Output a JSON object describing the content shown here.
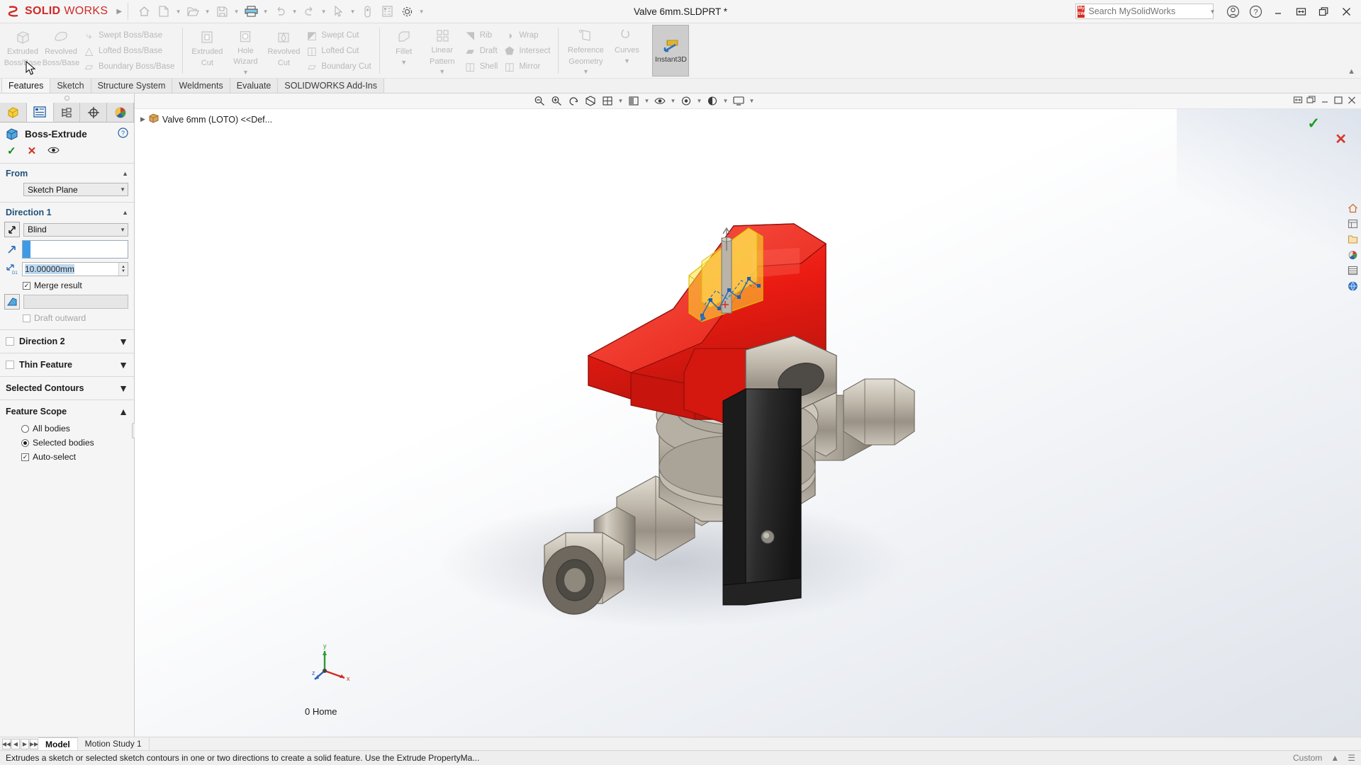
{
  "titlebar": {
    "brand_ds": "3S",
    "brand_solid": "SOLID",
    "brand_works": "WORKS",
    "document_title": "Valve 6mm.SLDPRT *",
    "quick_access": [
      {
        "name": "home-icon",
        "glyph": "⌂",
        "has_dropdown": false
      },
      {
        "name": "new-document-icon",
        "glyph": "▢",
        "has_dropdown": true
      },
      {
        "name": "open-folder-icon",
        "glyph": "◱",
        "has_dropdown": true
      },
      {
        "name": "save-icon",
        "glyph": "Ὃe",
        "has_dropdown": true
      },
      {
        "name": "print-icon",
        "glyph": "⎙",
        "has_dropdown": true
      },
      {
        "name": "undo-icon",
        "glyph": "↶",
        "has_dropdown": true
      },
      {
        "name": "redo-icon",
        "glyph": "↷",
        "has_dropdown": true
      },
      {
        "name": "select-arrow-icon",
        "glyph": "➤",
        "has_dropdown": true
      },
      {
        "name": "measure-icon",
        "glyph": "○",
        "has_dropdown": false
      },
      {
        "name": "rebuild-icon",
        "glyph": "☰",
        "has_dropdown": false
      },
      {
        "name": "options-gear-icon",
        "glyph": "⚙",
        "has_dropdown": true
      }
    ],
    "search_placeholder": "Search MySolidWorks",
    "search_value": "",
    "mysw_line1": "My",
    "mysw_line2": "SW",
    "account_icon": "ⓘ",
    "help_icon": "?",
    "minimize": "–",
    "restore": "⧉",
    "maximize": "❐",
    "close": "✕"
  },
  "ribbon": {
    "groups": [
      {
        "name": "boss-base-group",
        "big": [
          {
            "label1": "Extruded",
            "label2": "Boss/Base",
            "icon": "extruded-boss-base-icon",
            "glyph": "⬟"
          },
          {
            "label1": "Revolved",
            "label2": "Boss/Base",
            "icon": "revolved-boss-base-icon",
            "glyph": "◔"
          }
        ],
        "small": [
          {
            "label": "Swept Boss/Base",
            "icon": "swept-boss-base-icon",
            "glyph": "⤴"
          },
          {
            "label": "Lofted Boss/Base",
            "icon": "lofted-boss-base-icon",
            "glyph": "▲"
          },
          {
            "label": "Boundary Boss/Base",
            "icon": "boundary-boss-base-icon",
            "glyph": "▱"
          }
        ]
      },
      {
        "name": "cut-group",
        "big": [
          {
            "label1": "Extruded",
            "label2": "Cut",
            "icon": "extruded-cut-icon",
            "glyph": "▣",
            "caret": false
          },
          {
            "label1": "Hole",
            "label2": "Wizard",
            "icon": "hole-wizard-icon",
            "glyph": "◎",
            "caret": true
          },
          {
            "label1": "Revolved",
            "label2": "Cut",
            "icon": "revolved-cut-icon",
            "glyph": "∩"
          }
        ],
        "small": [
          {
            "label": "Swept Cut",
            "icon": "swept-cut-icon",
            "glyph": "◩"
          },
          {
            "label": "Lofted Cut",
            "icon": "lofted-cut-icon",
            "glyph": "◫"
          },
          {
            "label": "Boundary Cut",
            "icon": "boundary-cut-icon",
            "glyph": "▱"
          }
        ]
      },
      {
        "name": "feature-group",
        "big": [
          {
            "label1": "Fillet",
            "label2": "",
            "icon": "fillet-icon",
            "glyph": "◖",
            "caret": true
          },
          {
            "label1": "Linear",
            "label2": "Pattern",
            "icon": "linear-pattern-icon",
            "glyph": "∷",
            "caret": true
          }
        ],
        "small": [
          {
            "label": "Rib",
            "icon": "rib-icon",
            "glyph": "◥"
          },
          {
            "label": "Draft",
            "icon": "draft-icon",
            "glyph": "▰"
          },
          {
            "label": "Shell",
            "icon": "shell-icon",
            "glyph": "◫"
          }
        ],
        "small2": [
          {
            "label": "Wrap",
            "icon": "wrap-icon",
            "glyph": "◑"
          },
          {
            "label": "Intersect",
            "icon": "intersect-icon",
            "glyph": "⬟"
          },
          {
            "label": "Mirror",
            "icon": "mirror-icon",
            "glyph": "◫"
          }
        ]
      },
      {
        "name": "reference-group",
        "big": [
          {
            "label1": "Reference",
            "label2": "Geometry",
            "icon": "reference-geometry-icon",
            "glyph": "◱",
            "caret": true
          },
          {
            "label1": "Curves",
            "label2": "",
            "icon": "curves-icon",
            "glyph": "∿",
            "caret": true
          }
        ]
      }
    ],
    "instant3d": {
      "label": "Instant3D",
      "icon": "instant3d-icon",
      "glyph": "↙",
      "active": true
    },
    "collapse_icon": "⌃"
  },
  "tabs": [
    {
      "label": "Features",
      "active": true
    },
    {
      "label": "Sketch",
      "active": false
    },
    {
      "label": "Structure System",
      "active": false
    },
    {
      "label": "Weldments",
      "active": false
    },
    {
      "label": "Evaluate",
      "active": false
    },
    {
      "label": "SOLIDWORKS Add-Ins",
      "active": false
    }
  ],
  "property_manager": {
    "tabs": [
      {
        "name": "feature-manager-tab",
        "glyph": "⬟",
        "active": false
      },
      {
        "name": "property-manager-tab",
        "glyph": "☰",
        "active": true
      },
      {
        "name": "configuration-manager-tab",
        "glyph": "⑂",
        "active": false
      },
      {
        "name": "dimxpert-manager-tab",
        "glyph": "⊕",
        "active": false
      },
      {
        "name": "display-manager-tab",
        "glyph": "◕",
        "active": false
      }
    ],
    "title": "Boss-Extrude",
    "title_icon": "boss-extrude-icon",
    "actions": {
      "ok": "✓",
      "cancel": "✕",
      "preview": "◉"
    },
    "from": {
      "section": "From",
      "value": "Sketch Plane",
      "chevron": "⌄"
    },
    "direction1": {
      "section": "Direction 1",
      "end_condition": "Blind",
      "direction_icon": "reverse-direction-icon",
      "selection_value": "",
      "depth_value": "10.00000mm",
      "merge_result": {
        "label": "Merge result",
        "checked": true
      },
      "draft_angle": "",
      "draft_outward": {
        "label": "Draft outward",
        "checked": false,
        "disabled": true
      }
    },
    "direction2": {
      "label": "Direction 2",
      "checked": false
    },
    "thin_feature": {
      "label": "Thin Feature",
      "checked": false
    },
    "selected_contours": {
      "label": "Selected Contours"
    },
    "feature_scope": {
      "label": "Feature Scope",
      "options": [
        {
          "label": "All bodies",
          "selected": false
        },
        {
          "label": "Selected bodies",
          "selected": true
        }
      ],
      "auto_select": {
        "label": "Auto-select",
        "checked": true
      }
    },
    "chevrons": {
      "up": "⌃",
      "down": "⌄"
    }
  },
  "graphics": {
    "toolbar": [
      {
        "name": "zoom-to-fit-icon",
        "glyph": "⌕",
        "dropdown": false
      },
      {
        "name": "zoom-area-icon",
        "glyph": "⌕",
        "dropdown": false
      },
      {
        "name": "previous-view-icon",
        "glyph": "↺",
        "dropdown": false
      },
      {
        "name": "section-view-icon",
        "glyph": "◧",
        "dropdown": false
      },
      {
        "name": "view-orientation-icon",
        "glyph": "▦",
        "dropdown": true
      },
      {
        "name": "display-style-icon",
        "glyph": "◑",
        "dropdown": true
      },
      {
        "name": "hide-show-items-icon",
        "glyph": "◈",
        "dropdown": true
      },
      {
        "name": "appearances-icon",
        "glyph": "●",
        "dropdown": true
      },
      {
        "name": "scene-icon",
        "glyph": "◐",
        "dropdown": true
      },
      {
        "name": "view-settings-icon",
        "glyph": "▭",
        "dropdown": true
      }
    ],
    "window_buttons": [
      {
        "name": "restore-doc-icon",
        "glyph": "❐"
      },
      {
        "name": "undock-doc-icon",
        "glyph": "⧉"
      },
      {
        "name": "minimize-doc-icon",
        "glyph": "–"
      },
      {
        "name": "maximize-doc-icon",
        "glyph": "❐"
      },
      {
        "name": "close-doc-icon",
        "glyph": "✕"
      }
    ],
    "tree_root": "Valve 6mm (LOTO) <<Def...",
    "tree_expand": "▶",
    "confirm_ok": "✓",
    "confirm_cancel": "✕",
    "right_rail": [
      {
        "name": "view-home-icon",
        "glyph": "⌂"
      },
      {
        "name": "appearances-panel-icon",
        "glyph": "▤"
      },
      {
        "name": "scenes-panel-icon",
        "glyph": "▧"
      },
      {
        "name": "decals-panel-icon",
        "glyph": "◕"
      },
      {
        "name": "custom-properties-icon",
        "glyph": "☰"
      },
      {
        "name": "view-palette-icon",
        "glyph": "◔"
      }
    ],
    "axis": {
      "x": "x",
      "y": "y",
      "z": "z"
    },
    "home_label": "0 Home"
  },
  "bottom": {
    "nav": [
      "⏮",
      "◀",
      "▶",
      "⏭"
    ],
    "tabs": [
      {
        "label": "Model",
        "active": true
      },
      {
        "label": "Motion Study 1",
        "active": false
      }
    ],
    "status_message": "Extrudes a sketch or selected sketch contours in one or two directions to create a solid feature. Use the Extrude PropertyMa...",
    "custom_label": "Custom",
    "right_icons": [
      "▲",
      "≡"
    ]
  },
  "colors": {
    "brand_red": "#cf2a27",
    "accent_blue": "#3f9ae5",
    "section_heading": "#21517a",
    "valve_handle_red": "#e8231c",
    "valve_metal": "#b9b2a6",
    "valve_dark": "#2e2e2e",
    "sketch_yellow": "#f5d11e"
  }
}
